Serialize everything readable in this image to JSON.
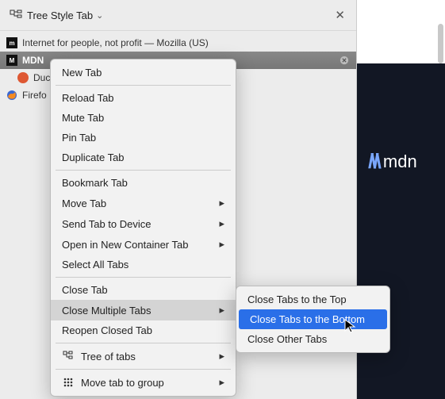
{
  "header": {
    "title": "Tree Style Tab"
  },
  "tabs": [
    {
      "label": "Internet for people, not profit — Mozilla (US)",
      "active": false
    },
    {
      "label": "MDN",
      "active": true
    },
    {
      "label": "Duck",
      "active": false
    },
    {
      "label": "Firefo",
      "active": false
    }
  ],
  "menu": {
    "new_tab": "New Tab",
    "reload_tab": "Reload Tab",
    "mute_tab": "Mute Tab",
    "pin_tab": "Pin Tab",
    "duplicate_tab": "Duplicate Tab",
    "bookmark_tab": "Bookmark Tab",
    "move_tab": "Move Tab",
    "send_tab": "Send Tab to Device",
    "open_container": "Open in New Container Tab",
    "select_all": "Select All Tabs",
    "close_tab": "Close Tab",
    "close_multiple": "Close Multiple Tabs",
    "reopen_closed": "Reopen Closed Tab",
    "tree_of_tabs": "Tree of tabs",
    "move_to_group": "Move tab to group"
  },
  "submenu": {
    "close_top": "Close Tabs to the Top",
    "close_bottom": "Close Tabs to the Bottom",
    "close_other": "Close Other Tabs"
  },
  "right_pane": {
    "logo_text": "mdn"
  }
}
